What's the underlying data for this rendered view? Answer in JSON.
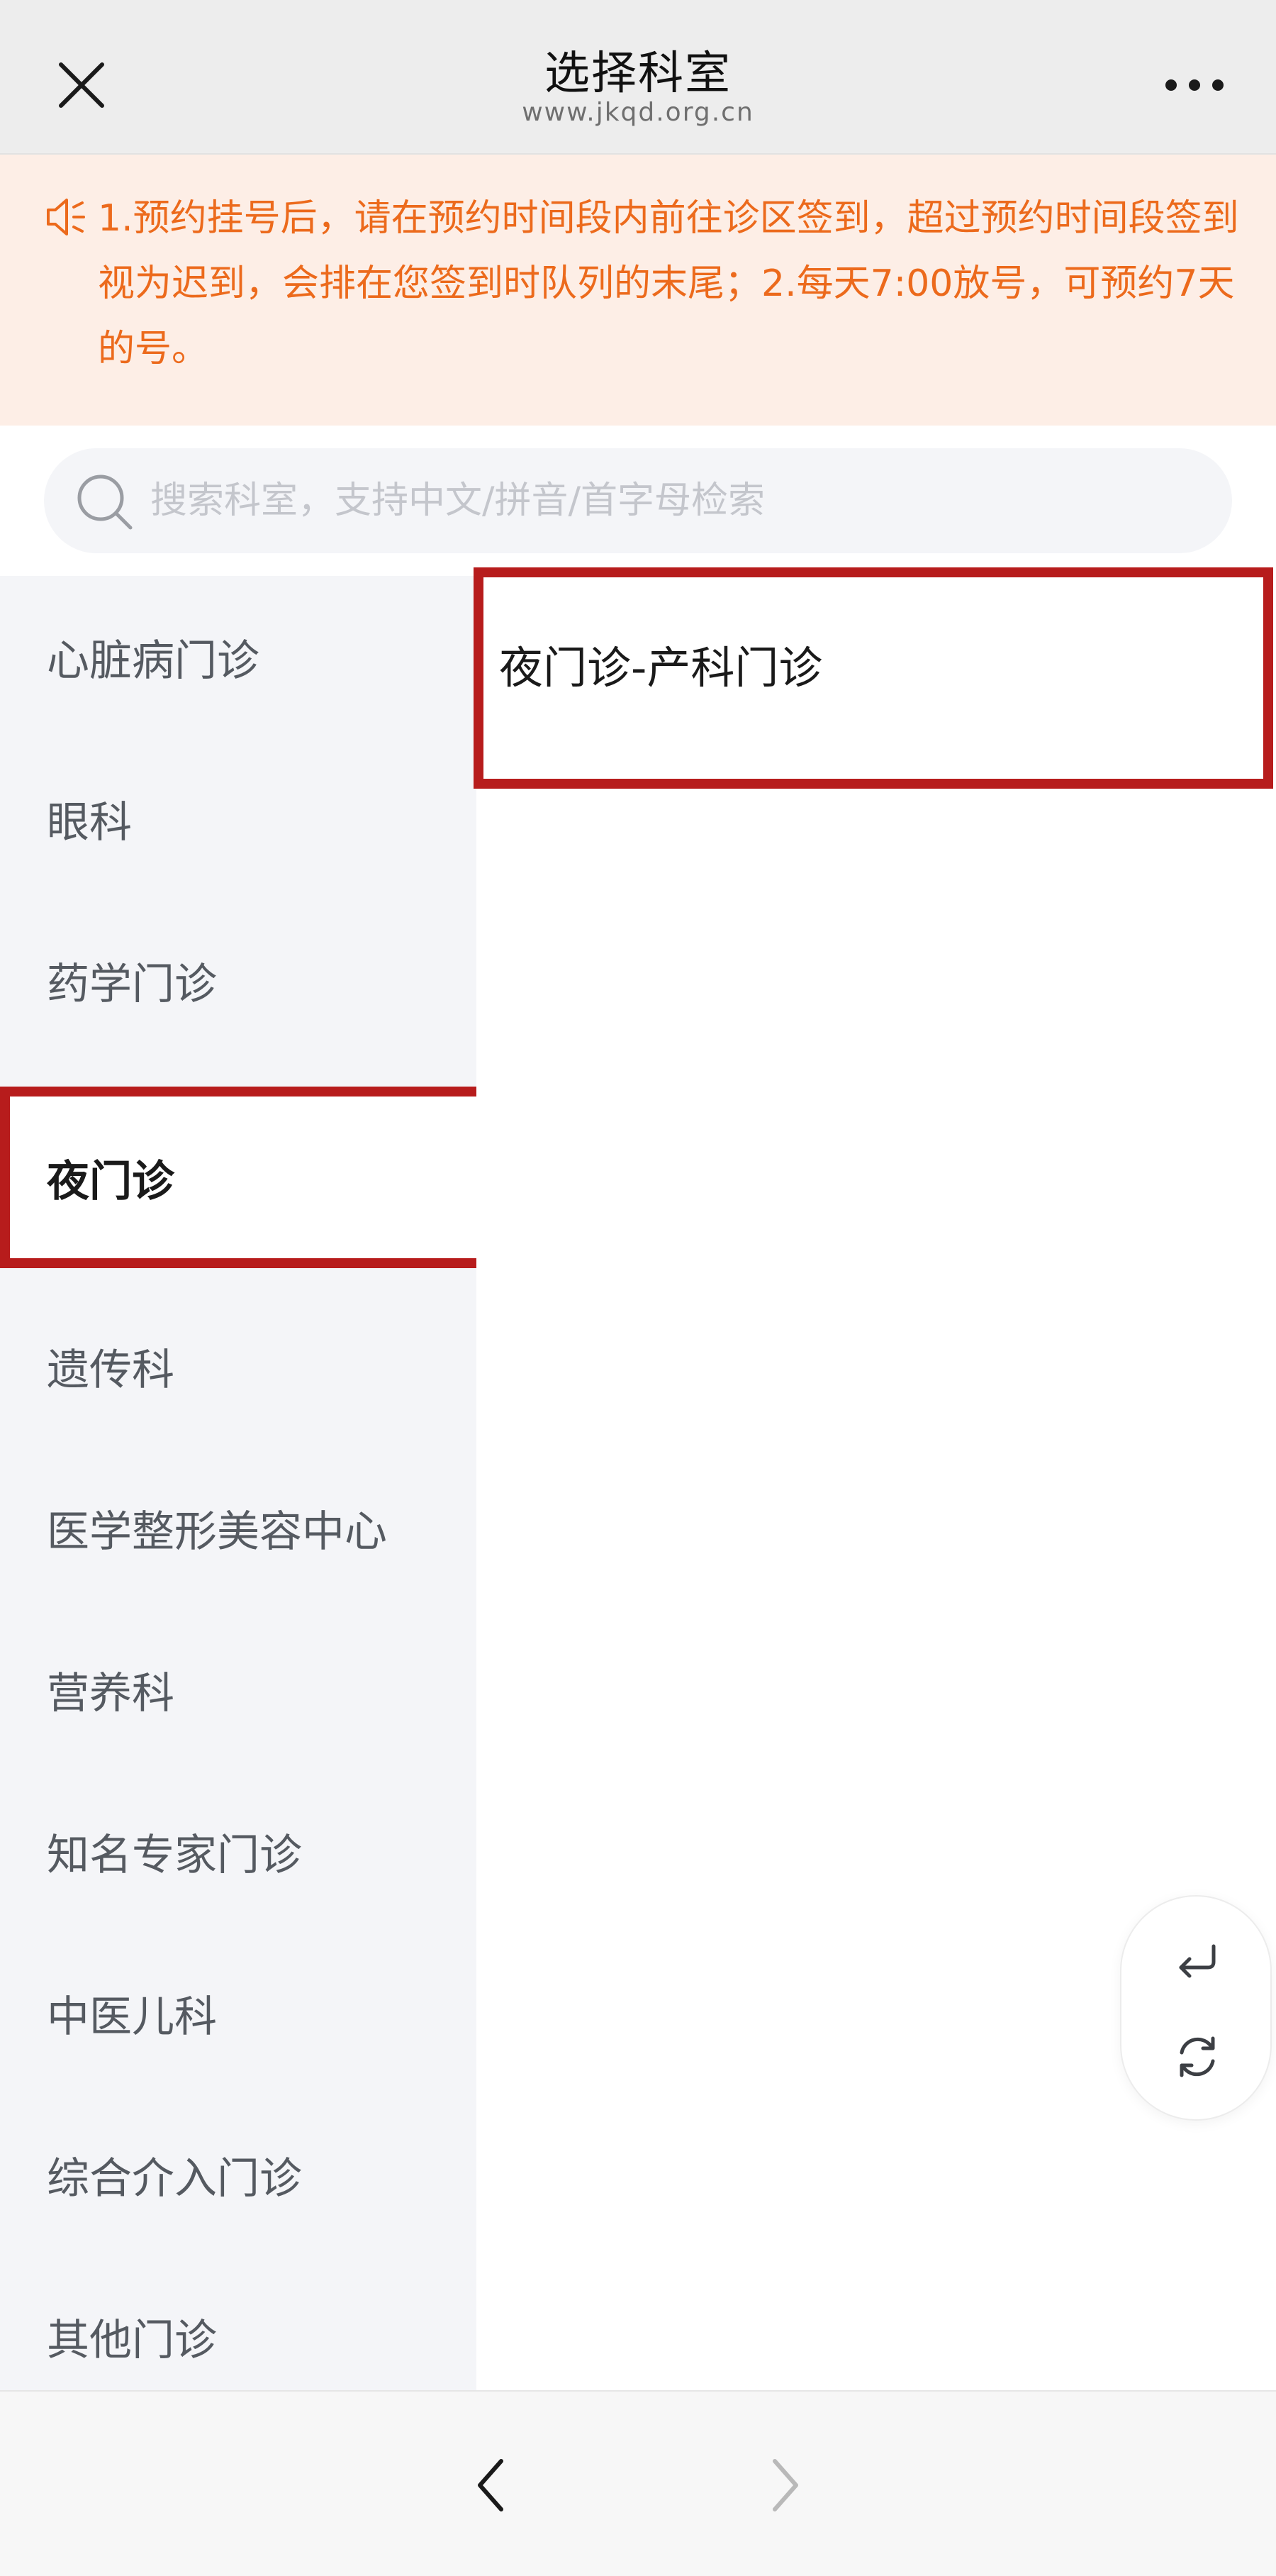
{
  "header": {
    "title": "选择科室",
    "subtitle": "www.jkqd.org.cn"
  },
  "notice": {
    "text": "1.预约挂号后，请在预约时间段内前往诊区签到，超过预约时间段签到视为迟到，会排在您签到时队列的末尾；2.每天7:00放号，可预约7天的号。"
  },
  "search": {
    "placeholder": "搜索科室，支持中文/拼音/首字母检索"
  },
  "sidebar": {
    "items": [
      {
        "label": "心脏病门诊"
      },
      {
        "label": "眼科"
      },
      {
        "label": "药学门诊"
      },
      {
        "label": "夜门诊"
      },
      {
        "label": "遗传科"
      },
      {
        "label": "医学整形美容中心"
      },
      {
        "label": "营养科"
      },
      {
        "label": "知名专家门诊"
      },
      {
        "label": "中医儿科"
      },
      {
        "label": "综合介入门诊"
      },
      {
        "label": "其他门诊"
      }
    ],
    "selected_index": 3
  },
  "content": {
    "items": [
      {
        "label": "夜门诊-产科门诊"
      }
    ]
  },
  "icons": {
    "close": "close-icon",
    "more": "more-icon",
    "speaker": "speaker-icon",
    "search": "search-icon",
    "return": "return-icon",
    "refresh": "refresh-icon",
    "back": "chevron-left-icon",
    "forward": "chevron-right-icon"
  },
  "colors": {
    "notice_text": "#ec6a1c",
    "notice_bg": "#fdeee6",
    "highlight_border": "#b71c1c",
    "sidebar_bg": "#f4f5f8"
  }
}
